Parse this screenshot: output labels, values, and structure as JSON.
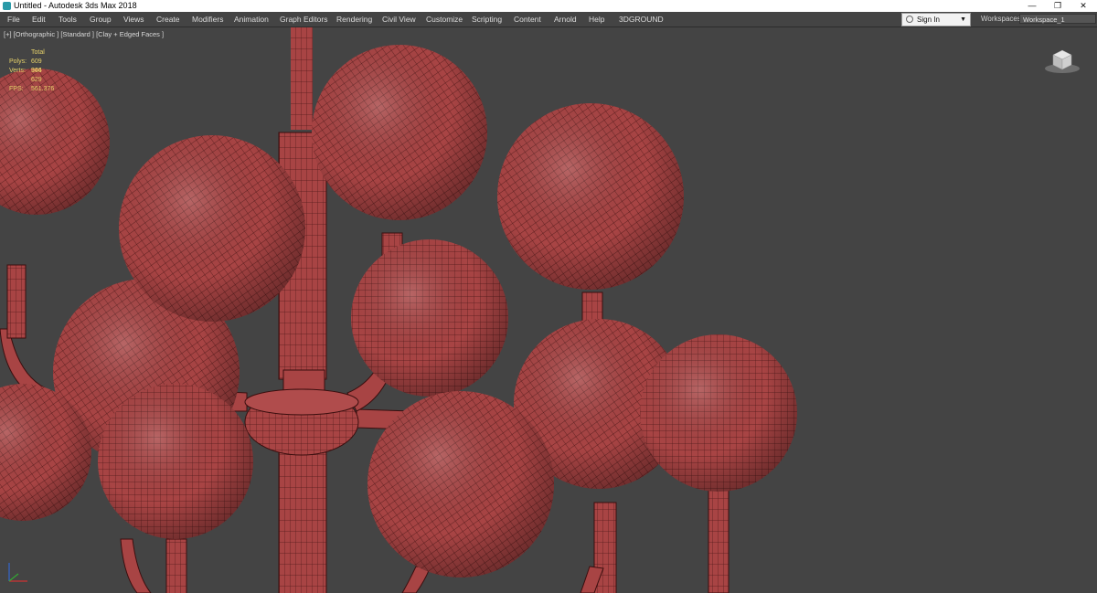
{
  "window": {
    "title": "Untitled - Autodesk 3ds Max 2018",
    "controls": {
      "minimize": "—",
      "maximize": "❐",
      "close": "✕"
    }
  },
  "menu": [
    "File",
    "Edit",
    "Tools",
    "Group",
    "Views",
    "Create",
    "Modifiers",
    "Animation",
    "Graph Editors",
    "Rendering",
    "Civil View",
    "Customize",
    "Scripting",
    "Content",
    "Arnold",
    "Help",
    "3DGROUND"
  ],
  "signin": {
    "label": "Sign In"
  },
  "workspace": {
    "label": "Workspaces:",
    "value": "Workspace_1"
  },
  "viewport": {
    "label": "[+] [Orthographic ] [Standard ] [Clay + Edged Faces ]",
    "stats": {
      "header": "Total",
      "polys_label": "Polys:",
      "polys": "609 944",
      "verts_label": "Verts:",
      "verts": "306 629",
      "fps_label": "FPS:",
      "fps": "561.376"
    }
  },
  "colors": {
    "clay": "#a84444",
    "wire": "#3a0e0e",
    "background": "#444444",
    "stats_text": "#e8d36a"
  }
}
